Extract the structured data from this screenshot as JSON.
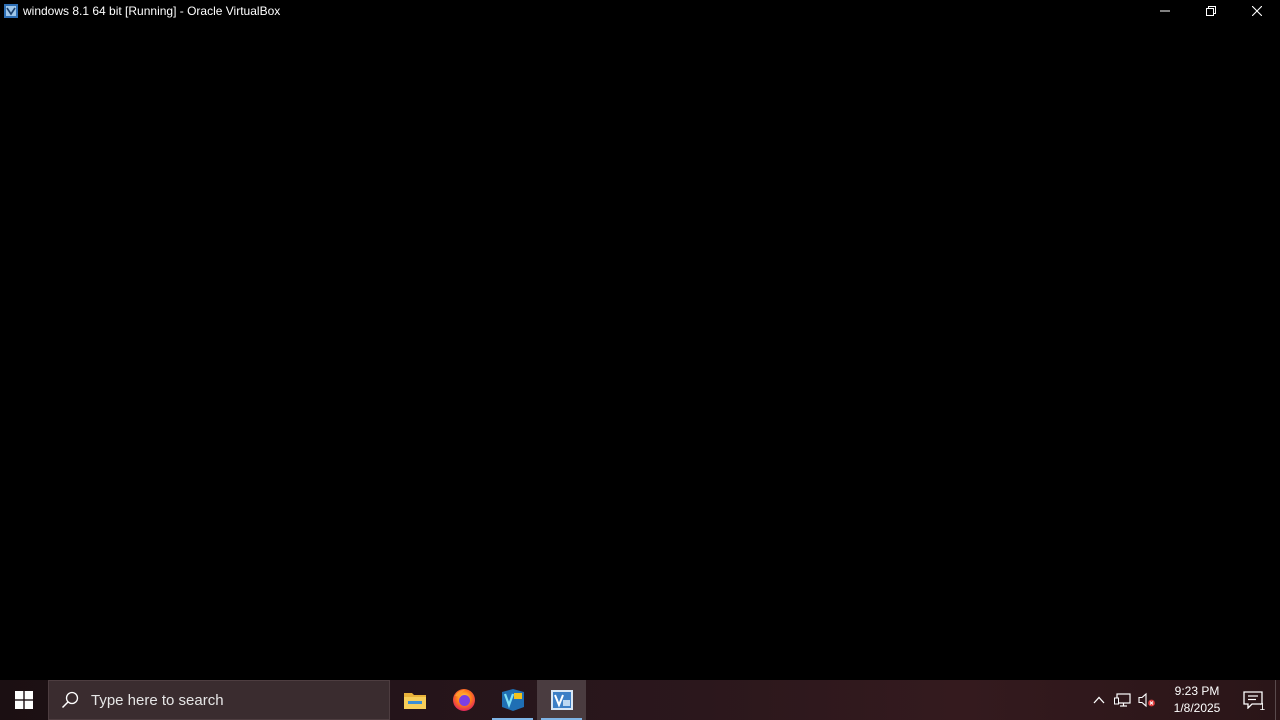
{
  "window": {
    "title": "windows 8.1 64 bit [Running] - Oracle VirtualBox",
    "controls": {
      "minimize": "minimize",
      "restore": "restore",
      "close": "close"
    }
  },
  "taskbar": {
    "search_placeholder": "Type here to search",
    "apps": [
      {
        "name": "File Explorer",
        "icon": "folder-icon",
        "active": false
      },
      {
        "name": "Firefox",
        "icon": "firefox-icon",
        "active": false
      },
      {
        "name": "VirtualBox Manager",
        "icon": "virtualbox-icon",
        "active": false,
        "underline": true
      },
      {
        "name": "windows 8.1 64 bit [Running] - Oracle VirtualBox",
        "icon": "virtualbox-vm-icon",
        "active": true,
        "underline": true
      }
    ],
    "tray": {
      "clock_time": "9:23 PM",
      "clock_date": "1/8/2025",
      "notification_count": "1",
      "icons": [
        "chevron-up-icon",
        "network-icon",
        "volume-muted-icon"
      ]
    }
  },
  "colors": {
    "vm_background": "#000000",
    "taskbar_active": "#4a3c40",
    "taskbar_underline": "#7fb4e6"
  }
}
